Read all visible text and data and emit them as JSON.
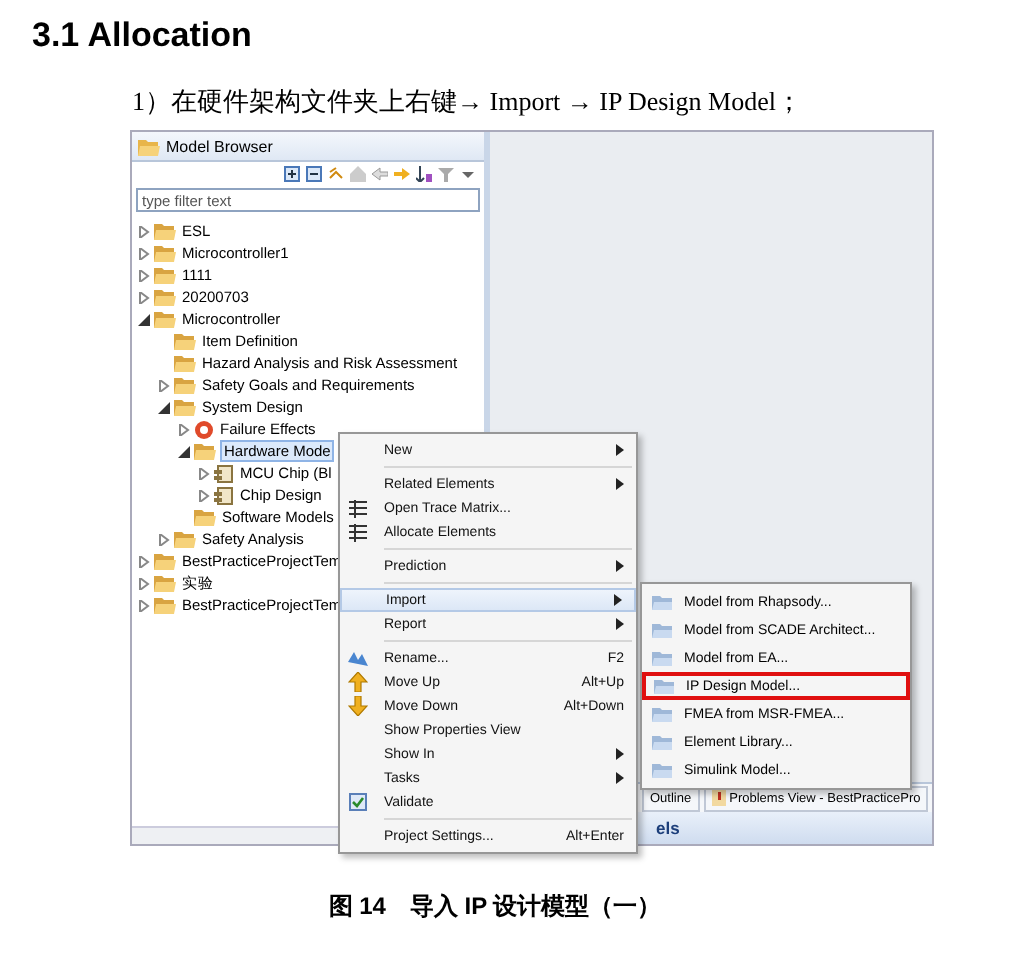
{
  "heading": "3.1 Allocation",
  "instruction": "1）在硬件架构文件夹上右键→ Import → IP Design Model；",
  "model_browser": {
    "title": "Model Browser",
    "filter": {
      "placeholder": "type filter text"
    },
    "tree": [
      {
        "label": "ESL",
        "kind": "folder",
        "expanded": false,
        "selected": false
      },
      {
        "label": "Microcontroller1",
        "kind": "folder",
        "expanded": false,
        "selected": false
      },
      {
        "label": "1111",
        "kind": "folder",
        "expanded": false,
        "selected": false
      },
      {
        "label": "20200703",
        "kind": "folder",
        "expanded": false,
        "selected": false
      },
      {
        "label": "Microcontroller",
        "kind": "folder",
        "expanded": true,
        "selected": false,
        "children": [
          {
            "label": "Item Definition",
            "kind": "folder",
            "selected": false
          },
          {
            "label": "Hazard Analysis and Risk Assessment",
            "kind": "folder",
            "selected": false
          },
          {
            "label": "Safety Goals and Requirements",
            "kind": "folder",
            "expanded": false,
            "selected": false
          },
          {
            "label": "System Design",
            "kind": "folder",
            "expanded": true,
            "selected": false,
            "children": [
              {
                "label": "Failure Effects",
                "kind": "failure",
                "expanded": false,
                "selected": false
              },
              {
                "label": "Hardware Mode",
                "kind": "folder",
                "expanded": true,
                "selected": true,
                "children": [
                  {
                    "label": "MCU Chip (Bl",
                    "kind": "component",
                    "expanded": false,
                    "selected": false
                  },
                  {
                    "label": "Chip Design",
                    "kind": "component",
                    "expanded": false,
                    "selected": false
                  }
                ]
              },
              {
                "label": "Software Models",
                "kind": "folder",
                "selected": false
              }
            ]
          },
          {
            "label": "Safety Analysis",
            "kind": "folder",
            "expanded": false,
            "selected": false
          }
        ]
      },
      {
        "label": "BestPracticeProjectTem",
        "kind": "folder",
        "expanded": false,
        "selected": false
      },
      {
        "label": "实验",
        "kind": "folder",
        "expanded": false,
        "selected": false
      },
      {
        "label": "BestPracticeProjectTem",
        "kind": "folder",
        "expanded": false,
        "selected": false
      }
    ]
  },
  "bottom_panel": {
    "tabs": [
      {
        "label": "Outline",
        "kind": "plain"
      },
      {
        "label": "Problems View - BestPracticePro",
        "kind": "problems"
      }
    ],
    "title": "els"
  },
  "context_menu": {
    "groups": [
      [
        {
          "label": "New",
          "kind": "plain",
          "submenu": true,
          "selected": false
        }
      ],
      [
        {
          "label": "Related Elements",
          "kind": "plain",
          "submenu": true,
          "selected": false
        },
        {
          "label": "Open Trace Matrix...",
          "kind": "matrix",
          "submenu": false,
          "selected": false
        },
        {
          "label": "Allocate Elements",
          "kind": "matrix",
          "submenu": false,
          "selected": false
        }
      ],
      [
        {
          "label": "Prediction",
          "kind": "plain",
          "submenu": true,
          "selected": false
        }
      ],
      [
        {
          "label": "Import",
          "kind": "plain",
          "submenu": true,
          "selected": true
        },
        {
          "label": "Report",
          "kind": "plain",
          "submenu": true,
          "selected": false
        }
      ],
      [
        {
          "label": "Rename...",
          "kind": "rename",
          "shortcut": "F2",
          "submenu": false,
          "selected": false
        },
        {
          "label": "Move Up",
          "kind": "up",
          "shortcut": "Alt+Up",
          "submenu": false,
          "selected": false
        },
        {
          "label": "Move Down",
          "kind": "down",
          "shortcut": "Alt+Down",
          "submenu": false,
          "selected": false
        },
        {
          "label": "Show Properties View",
          "kind": "plain",
          "submenu": false,
          "selected": false
        },
        {
          "label": "Show In",
          "kind": "plain",
          "submenu": true,
          "selected": false
        },
        {
          "label": "Tasks",
          "kind": "plain",
          "submenu": true,
          "selected": false
        },
        {
          "label": "Validate",
          "kind": "validate",
          "submenu": false,
          "selected": false
        }
      ],
      [
        {
          "label": "Project Settings...",
          "kind": "plain",
          "shortcut": "Alt+Enter",
          "submenu": false,
          "selected": false
        }
      ]
    ]
  },
  "import_submenu": [
    {
      "label": "Model from Rhapsody...",
      "highlighted": false
    },
    {
      "label": "Model from SCADE Architect...",
      "highlighted": false
    },
    {
      "label": "Model from EA...",
      "highlighted": false
    },
    {
      "label": "IP Design Model...",
      "highlighted": true
    },
    {
      "label": "FMEA from MSR-FMEA...",
      "highlighted": false
    },
    {
      "label": "Element Library...",
      "highlighted": false
    },
    {
      "label": "Simulink Model...",
      "highlighted": false
    }
  ],
  "caption": "图 14　导入 IP 设计模型（一）"
}
